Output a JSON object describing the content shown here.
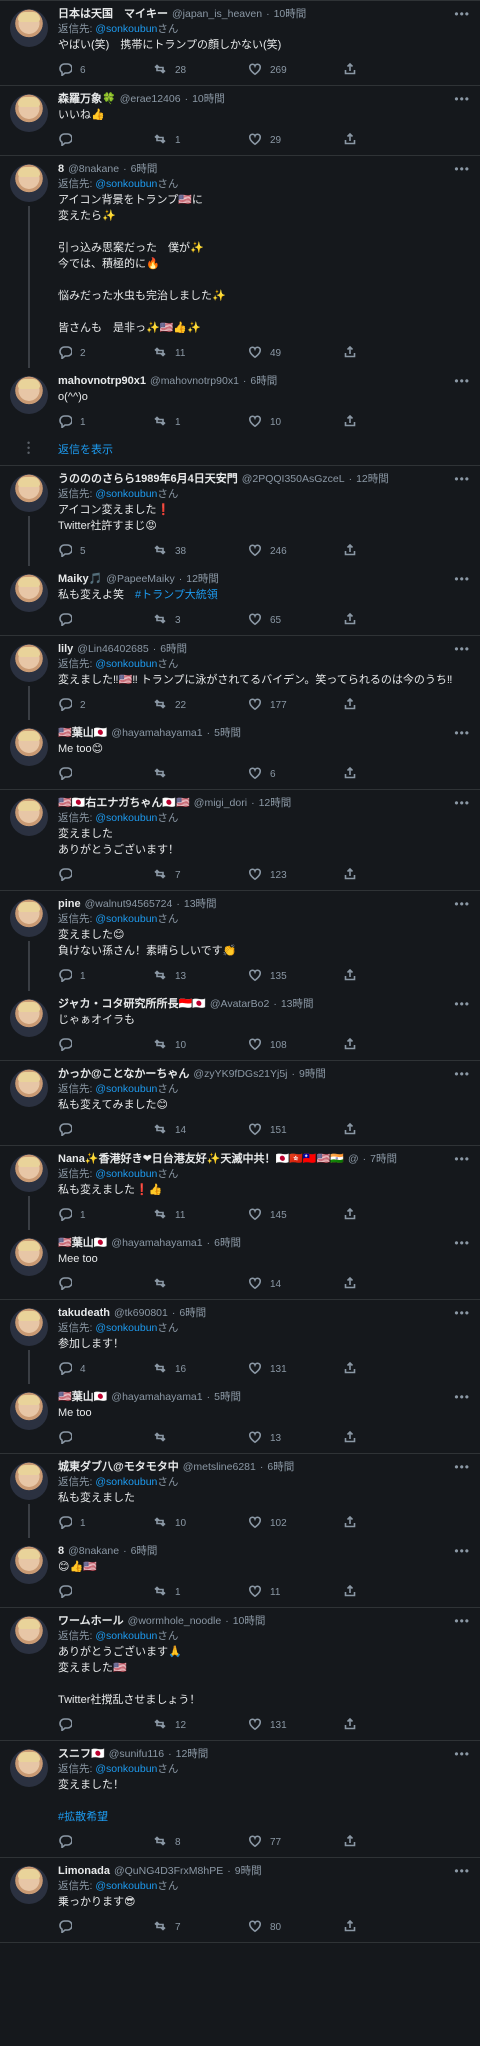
{
  "feed": {
    "reply_prefix": "返信先:",
    "show_replies_label": "返信を表示",
    "tweets": [
      {
        "id": "t1",
        "name": "日本は天国　マイキー",
        "handle": "@japan_is_heaven",
        "time": "10時間",
        "reply_to": "@sonkoubun",
        "reply_suffix": "さん",
        "body": "やばい(笑)　携帯にトランプの顔しかない(笑)",
        "replies": "6",
        "retweets": "28",
        "likes": "269",
        "sep": true,
        "thread_down": false
      },
      {
        "id": "t2",
        "name": "森羅万象🍀",
        "handle": "@erae12406",
        "time": "10時間",
        "reply_to": "",
        "reply_suffix": "",
        "body": "いいね👍",
        "replies": "",
        "retweets": "1",
        "likes": "29",
        "sep": true,
        "thread_down": false
      },
      {
        "id": "t3",
        "name": "8",
        "handle": "@8nakane",
        "time": "6時間",
        "reply_to": "@sonkoubun",
        "reply_suffix": "さん",
        "body": "アイコン背景をトランプ🇺🇸に\n変えたら✨\n\n引っ込み思案だった　僕が✨\n今では、積極的に🔥\n\n悩みだった水虫も完治しました✨\n\n皆さんも　是非っ✨🇺🇸👍✨",
        "replies": "2",
        "retweets": "11",
        "likes": "49",
        "sep": true,
        "thread_down": true
      },
      {
        "id": "t4",
        "name": "mahovnotrp90x1",
        "handle": "@mahovnotrp90x1",
        "time": "6時間",
        "reply_to": "",
        "reply_suffix": "",
        "body": "o(^^)o",
        "replies": "1",
        "retweets": "1",
        "likes": "10",
        "sep": false,
        "thread_down": false,
        "show_more": true
      },
      {
        "id": "t5",
        "name": "うのののさらら1989年6月4日天安門",
        "handle": "@2PQQI350AsGzceL",
        "time": "12時間",
        "reply_to": "@sonkoubun",
        "reply_suffix": "さん",
        "body": "アイコン変えました❗\nTwitter社許すまじ😡",
        "replies": "5",
        "retweets": "38",
        "likes": "246",
        "sep": true,
        "thread_down": true
      },
      {
        "id": "t6",
        "name": "Maiky🎵",
        "handle": "@PapeeMaiky",
        "time": "12時間",
        "reply_to": "",
        "reply_suffix": "",
        "body": "私も変えよ笑　#トランプ大統領",
        "replies": "",
        "retweets": "3",
        "likes": "65",
        "sep": false,
        "thread_down": false
      },
      {
        "id": "t7",
        "name": "lily",
        "handle": "@Lin46402685",
        "time": "6時間",
        "reply_to": "@sonkoubun",
        "reply_suffix": "さん",
        "body": "変えました‼🇺🇸‼ トランプに泳がされてるバイデン。笑ってられるのは今のうち‼",
        "replies": "2",
        "retweets": "22",
        "likes": "177",
        "sep": true,
        "thread_down": true
      },
      {
        "id": "t8",
        "name": "🇺🇸葉山🇯🇵",
        "handle": "@hayamahayama1",
        "time": "5時間",
        "reply_to": "",
        "reply_suffix": "",
        "body": "Me too😊",
        "replies": "",
        "retweets": "",
        "likes": "6",
        "sep": false,
        "thread_down": false
      },
      {
        "id": "t9",
        "name": "🇺🇸🇯🇵右エナガちゃん🇯🇵🇺🇸",
        "handle": "@migi_dori",
        "time": "12時間",
        "reply_to": "@sonkoubun",
        "reply_suffix": "さん",
        "body": "変えました\nありがとうございます！",
        "replies": "",
        "retweets": "7",
        "likes": "123",
        "sep": true,
        "thread_down": false
      },
      {
        "id": "t10",
        "name": "pine",
        "handle": "@walnut94565724",
        "time": "13時間",
        "reply_to": "@sonkoubun",
        "reply_suffix": "さん",
        "body": "変えました😊\n負けない孫さん！素晴らしいです👏",
        "replies": "1",
        "retweets": "13",
        "likes": "135",
        "sep": true,
        "thread_down": true
      },
      {
        "id": "t11",
        "name": "ジャカ・コタ研究所所長🇮🇩🇯🇵",
        "handle": "@AvatarBo2",
        "time": "13時間",
        "reply_to": "",
        "reply_suffix": "",
        "body": "じゃぁオイラも",
        "replies": "",
        "retweets": "10",
        "likes": "108",
        "sep": false,
        "thread_down": false
      },
      {
        "id": "t12",
        "name": "かっか@ことなかーちゃん",
        "handle": "@zyYK9fDGs21Yj5j",
        "time": "9時間",
        "reply_to": "@sonkoubun",
        "reply_suffix": "さん",
        "body": "私も変えてみました😊",
        "replies": "",
        "retweets": "14",
        "likes": "151",
        "sep": true,
        "thread_down": false
      },
      {
        "id": "t13",
        "name": "Nana✨香港好き❤日台港友好✨天滅中共！🇯🇵🇭🇰🇹🇼🇺🇸🇮🇳",
        "handle": "@",
        "time": "7時間",
        "reply_to": "@sonkoubun",
        "reply_suffix": "さん",
        "body": "私も変えました❗👍",
        "replies": "1",
        "retweets": "11",
        "likes": "145",
        "sep": true,
        "thread_down": true
      },
      {
        "id": "t14",
        "name": "🇺🇸葉山🇯🇵",
        "handle": "@hayamahayama1",
        "time": "6時間",
        "reply_to": "",
        "reply_suffix": "",
        "body": "Mee too",
        "replies": "",
        "retweets": "",
        "likes": "14",
        "sep": false,
        "thread_down": false
      },
      {
        "id": "t15",
        "name": "takudeath",
        "handle": "@tk690801",
        "time": "6時間",
        "reply_to": "@sonkoubun",
        "reply_suffix": "さん",
        "body": "参加します！",
        "replies": "4",
        "retweets": "16",
        "likes": "131",
        "sep": true,
        "thread_down": true
      },
      {
        "id": "t16",
        "name": "🇺🇸葉山🇯🇵",
        "handle": "@hayamahayama1",
        "time": "5時間",
        "reply_to": "",
        "reply_suffix": "",
        "body": "Me too",
        "replies": "",
        "retweets": "",
        "likes": "13",
        "sep": false,
        "thread_down": false
      },
      {
        "id": "t17",
        "name": "城東ダブ八@モタモタ中",
        "handle": "@metsline6281",
        "time": "6時間",
        "reply_to": "@sonkoubun",
        "reply_suffix": "さん",
        "body": "私も変えました",
        "replies": "1",
        "retweets": "10",
        "likes": "102",
        "sep": true,
        "thread_down": true
      },
      {
        "id": "t18",
        "name": "8",
        "handle": "@8nakane",
        "time": "6時間",
        "reply_to": "",
        "reply_suffix": "",
        "body": "😊👍🇺🇸",
        "replies": "",
        "retweets": "1",
        "likes": "11",
        "sep": false,
        "thread_down": false
      },
      {
        "id": "t19",
        "name": "ワームホール",
        "handle": "@wormhole_noodle",
        "time": "10時間",
        "reply_to": "@sonkoubun",
        "reply_suffix": "さん",
        "body": "ありがとうございます🙏\n変えました🇺🇸\n\nTwitter社撹乱させましょう！",
        "replies": "",
        "retweets": "12",
        "likes": "131",
        "sep": true,
        "thread_down": false
      },
      {
        "id": "t20",
        "name": "スニフ🇯🇵",
        "handle": "@sunifu116",
        "time": "12時間",
        "reply_to": "@sonkoubun",
        "reply_suffix": "さん",
        "body": "変えました！\n\n#拡散希望",
        "replies": "",
        "retweets": "8",
        "likes": "77",
        "sep": true,
        "thread_down": false
      },
      {
        "id": "t21",
        "name": "Limonada",
        "handle": "@QuNG4D3FrxM8hPE",
        "time": "9時間",
        "reply_to": "@sonkoubun",
        "reply_suffix": "さん",
        "body": "乗っかります😎",
        "replies": "",
        "retweets": "7",
        "likes": "80",
        "sep": true,
        "thread_down": false
      }
    ]
  }
}
